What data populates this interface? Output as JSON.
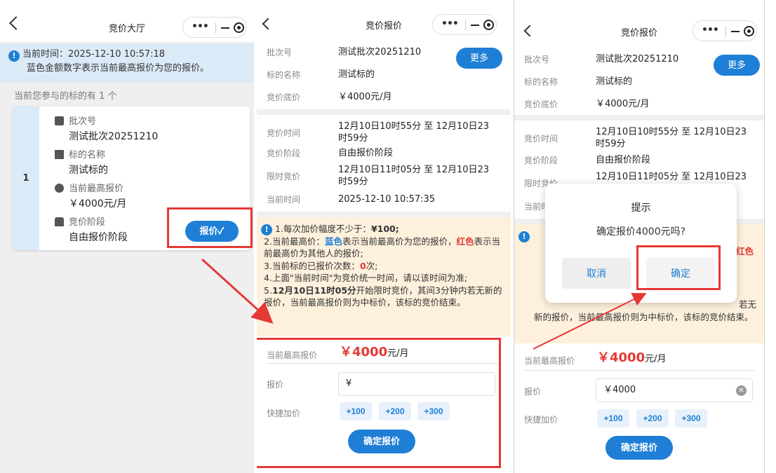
{
  "screen1": {
    "title": "竞价大厅",
    "notice_time": "当前时间：2025-12-10 10:57:18",
    "notice_hint": "蓝色金额数字表示当前最高报价为您的报价。",
    "count_text": "当前您参与的标的有 1 个",
    "lot": {
      "index": "1",
      "batch_label": "批次号",
      "batch_value": "测试批次20251210",
      "name_label": "标的名称",
      "name_value": "测试标的",
      "price_label": "当前最高报价",
      "price_value": "￥4000元/月",
      "stage_label": "竞价阶段",
      "stage_value": "自由报价阶段",
      "bid_button": "报价✓"
    }
  },
  "screen2": {
    "title": "竞价报价",
    "more_button": "更多",
    "info": [
      {
        "k": "批次号",
        "v": "测试批次20251210"
      },
      {
        "k": "标的名称",
        "v": "测试标的"
      },
      {
        "k": "竞价底价",
        "v": "￥4000元/月"
      }
    ],
    "times": [
      {
        "k": "竞价时间",
        "v": "12月10日10时55分 至 12月10日23时59分"
      },
      {
        "k": "竞价阶段",
        "v": "自由报价阶段"
      },
      {
        "k": "限时竞价",
        "v": "12月10日11时05分 至 12月10日23时59分"
      },
      {
        "k": "当前时间",
        "v": "2025-12-10 10:57:35"
      }
    ],
    "rules": {
      "r1a": "1.每次加价幅度不少于：",
      "r1b": "¥100;",
      "r2a": "2.当前最高价：",
      "r2b": "蓝色",
      "r2c": "表示当前最高价为您的报价，",
      "r2d": "红色",
      "r2e": "表示当前最高价为其他人的报价;",
      "r3a": "3.当前标的已报价次数：",
      "r3b": "0",
      "r3c": "次;",
      "r4": "4.上面\"当前时间\"为竞价统一时间，请以该时间为准;",
      "r5a": "5.",
      "r5b": "12月10日11时05分",
      "r5c": "开始限时竞价，其间3分钟内若无新的报价，当前最高报价则为中标价，该标的竞价结束。"
    },
    "highest_label": "当前最高报价",
    "highest_value": "￥4000",
    "highest_unit": "元/月",
    "bid_label": "报价",
    "bid_value": "¥",
    "quick_label": "快捷加价",
    "quick": [
      "+100",
      "+200",
      "+300"
    ],
    "confirm_button": "确定报价"
  },
  "screen3": {
    "title": "竞价报价",
    "more_button": "更多",
    "info": [
      {
        "k": "批次号",
        "v": "测试批次20251210"
      },
      {
        "k": "标的名称",
        "v": "测试标的"
      },
      {
        "k": "竞价底价",
        "v": "￥4000元/月"
      }
    ],
    "times": [
      {
        "k": "竞价时间",
        "v": "12月10日10时55分 至 12月10日23时59分"
      },
      {
        "k": "竞价阶段",
        "v": "自由报价阶段"
      },
      {
        "k": "限时竞价",
        "v": "12月10日11时05分 至 12月10日23时59分"
      },
      {
        "k": "当前时间",
        "v": ""
      }
    ],
    "rules_line": "新的报价，当前最高报价则为中标价，该标的竞价结束。",
    "rules_red": "红色",
    "rules_frag": "若无",
    "highest_label": "当前最高报价",
    "highest_value": "￥4000",
    "highest_unit": "元/月",
    "bid_label": "报价",
    "bid_value": "￥4000",
    "quick_label": "快捷加价",
    "quick": [
      "+100",
      "+200",
      "+300"
    ],
    "confirm_button": "确定报价",
    "dialog": {
      "title": "提示",
      "message": "确定报价4000元吗?",
      "cancel": "取消",
      "ok": "确定"
    }
  },
  "colors": {
    "accent": "#1f7fd6",
    "highlight": "#e53935",
    "notice_bg": "#dbeaf7",
    "rules_bg": "#fdf0dc"
  }
}
